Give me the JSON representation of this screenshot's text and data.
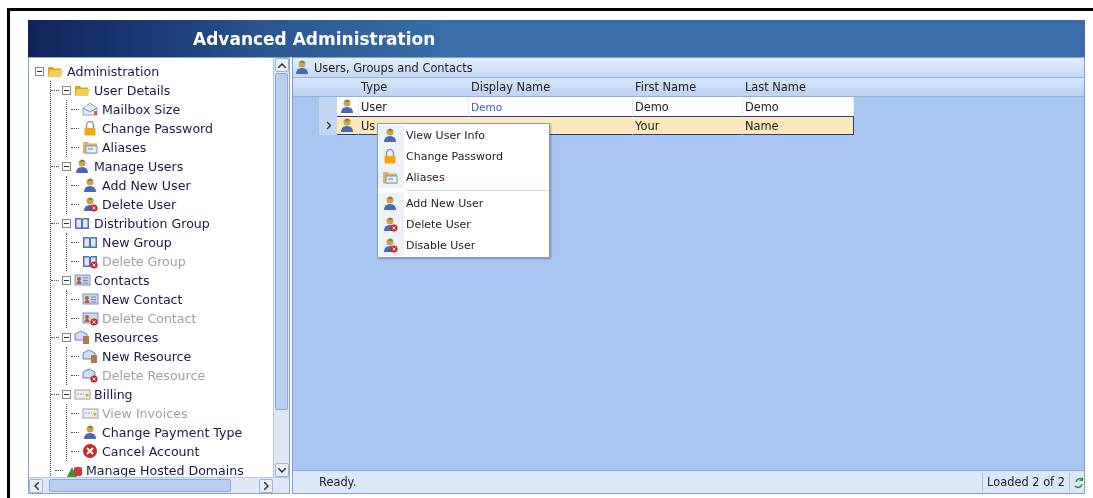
{
  "header": {
    "title": "Advanced Administration"
  },
  "tree": [
    {
      "label": "Administration",
      "kind": "folder-open",
      "expanded": true,
      "disabled": false,
      "children": [
        {
          "label": "User Details",
          "kind": "folder-open",
          "expanded": true,
          "disabled": false,
          "children": [
            {
              "label": "Mailbox Size",
              "kind": "mail",
              "disabled": false
            },
            {
              "label": "Change Password",
              "kind": "lock",
              "disabled": false
            },
            {
              "label": "Aliases",
              "kind": "folder-letter",
              "disabled": false
            }
          ]
        },
        {
          "label": "Manage Users",
          "kind": "user",
          "expanded": true,
          "disabled": false,
          "children": [
            {
              "label": "Add New User",
              "kind": "user",
              "disabled": false
            },
            {
              "label": "Delete User",
              "kind": "user-delete",
              "disabled": false
            }
          ]
        },
        {
          "label": "Distribution Group",
          "kind": "book",
          "expanded": true,
          "disabled": false,
          "children": [
            {
              "label": "New Group",
              "kind": "book",
              "disabled": false
            },
            {
              "label": "Delete Group",
              "kind": "book-delete",
              "disabled": true
            }
          ]
        },
        {
          "label": "Contacts",
          "kind": "card",
          "expanded": true,
          "disabled": false,
          "children": [
            {
              "label": "New Contact",
              "kind": "card",
              "disabled": false
            },
            {
              "label": "Delete Contact",
              "kind": "card-delete",
              "disabled": true
            }
          ]
        },
        {
          "label": "Resources",
          "kind": "resource",
          "expanded": true,
          "disabled": false,
          "children": [
            {
              "label": "New Resource",
              "kind": "resource",
              "disabled": false
            },
            {
              "label": "Delete Resource",
              "kind": "resource-delete",
              "disabled": true
            }
          ]
        },
        {
          "label": "Billing",
          "kind": "invoice",
          "expanded": true,
          "disabled": false,
          "children": [
            {
              "label": "View Invoices",
              "kind": "invoice",
              "disabled": true
            },
            {
              "label": "Change Payment Type",
              "kind": "user",
              "disabled": false
            },
            {
              "label": "Cancel Account",
              "kind": "cancel",
              "disabled": false
            }
          ]
        },
        {
          "label": "Manage Hosted Domains",
          "kind": "domain",
          "disabled": false
        }
      ]
    }
  ],
  "grid": {
    "title": "Users, Groups and Contacts",
    "columns": [
      "Type",
      "Display Name",
      "First Name",
      "Last Name"
    ],
    "rows": [
      {
        "selected": false,
        "type": "User",
        "display_name": "Demo",
        "first_name": "Demo",
        "last_name": "Demo"
      },
      {
        "selected": true,
        "type": "Us",
        "first_name": "Your",
        "last_name": "Name"
      }
    ]
  },
  "context_menu": [
    {
      "label": "View User Info",
      "kind": "user",
      "separator_before": false
    },
    {
      "label": "Change Password",
      "kind": "lock",
      "separator_before": false
    },
    {
      "label": "Aliases",
      "kind": "folder-letter",
      "separator_before": false
    },
    {
      "label": "Add New User",
      "kind": "user",
      "separator_before": true
    },
    {
      "label": "Delete User",
      "kind": "user-delete",
      "separator_before": false
    },
    {
      "label": "Disable User",
      "kind": "user-delete",
      "separator_before": false
    }
  ],
  "status_bar": {
    "message": "Ready.",
    "count": "Loaded 2 of 2"
  }
}
